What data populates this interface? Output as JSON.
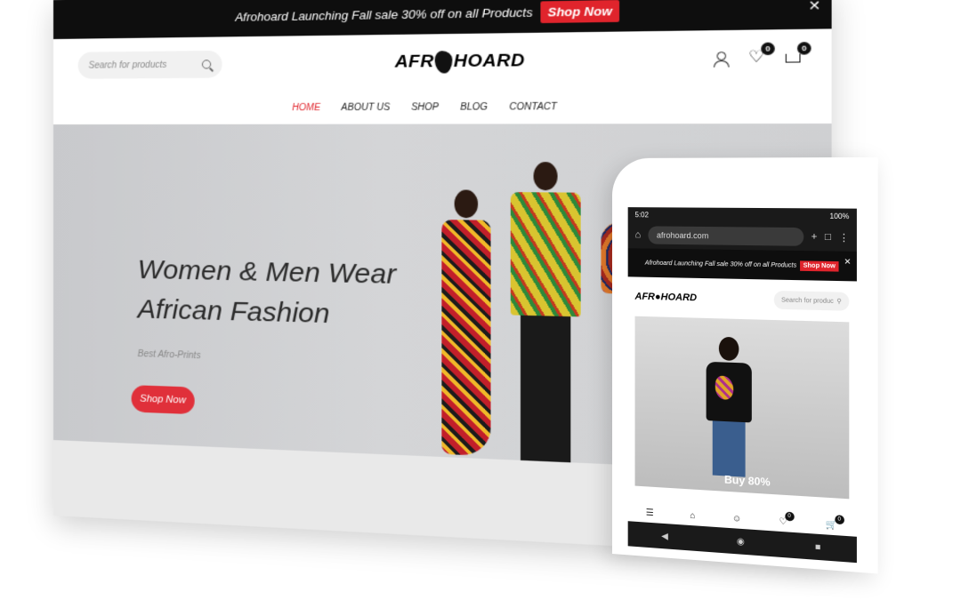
{
  "desktop": {
    "promo": {
      "text": "Afrohoard Launching Fall sale 30% off on all Products",
      "shop_label": "Shop Now",
      "close_label": "✕"
    },
    "search": {
      "placeholder": "Search for products"
    },
    "logo": {
      "part1": "AFR",
      "part2": "HOARD"
    },
    "header": {
      "wishlist_count": "0",
      "cart_count": "0"
    },
    "nav": [
      {
        "label": "HOME",
        "active": true
      },
      {
        "label": "ABOUT US"
      },
      {
        "label": "SHOP"
      },
      {
        "label": "BLOG"
      },
      {
        "label": "CONTACT"
      }
    ],
    "hero": {
      "title_line1": "Women & Men Wear",
      "title_line2": "African Fashion",
      "subtitle": "Best Afro-Prints",
      "button_label": "Shop Now"
    }
  },
  "phone": {
    "status": {
      "time": "5:02",
      "battery": "100%"
    },
    "url": "afrohoard.com",
    "promo": {
      "text": "Afrohoard Launching Fall sale 30% off on all Products",
      "shop_label": "Shop Now",
      "close_label": "✕"
    },
    "logo": "AFR●HOARD",
    "search": {
      "placeholder": "Search for produc"
    },
    "hero": {
      "buy_text": "Buy 80%"
    },
    "bottomnav": {
      "wishlist_count": "0",
      "cart_count": "0"
    }
  },
  "colors": {
    "accent": "#e0242c",
    "promo_bg": "#0e0e0e",
    "hero_bg": "#cfd0d2"
  },
  "icons": [
    "search-icon",
    "user-icon",
    "heart-icon",
    "cart-icon",
    "close-icon",
    "home-icon",
    "menu-icon",
    "back-icon",
    "recents-icon"
  ]
}
